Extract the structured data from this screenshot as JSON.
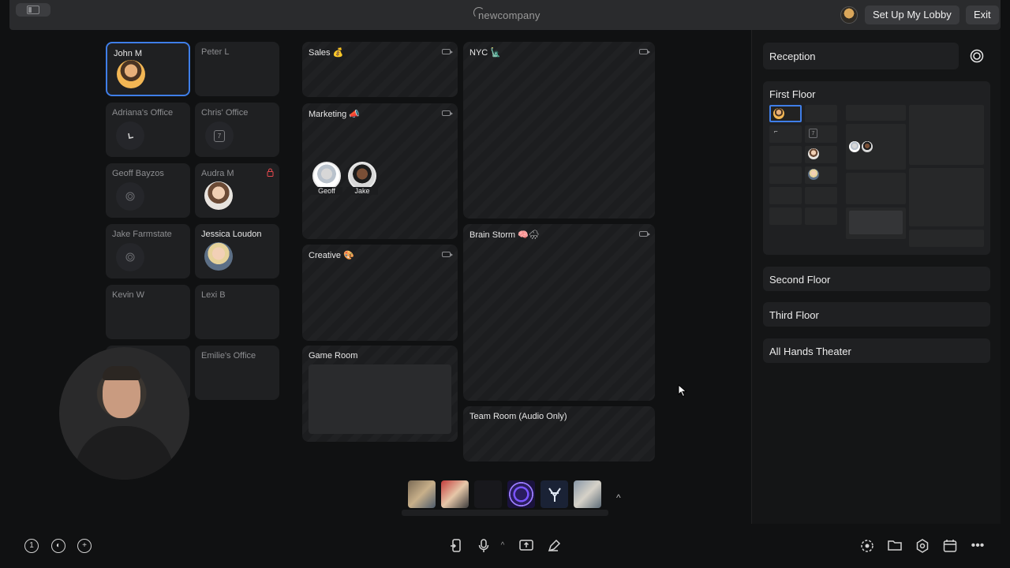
{
  "app": {
    "logo_text": "newcompany",
    "setup_lobby_label": "Set Up My Lobby",
    "exit_label": "Exit"
  },
  "offices": [
    {
      "name": "John M"
    },
    {
      "name": "Peter L"
    },
    {
      "name": "Adriana's Office"
    },
    {
      "name": "Chris' Office"
    },
    {
      "name": "Geoff Bayzos"
    },
    {
      "name": "Audra M"
    },
    {
      "name": "Jake Farmstate"
    },
    {
      "name": "Jessica Loudon"
    },
    {
      "name": "Kevin W"
    },
    {
      "name": "Lexi B"
    },
    {
      "name": "Emilie's Office"
    }
  ],
  "chris_office_day": "7",
  "rooms": {
    "sales": "Sales 💰",
    "marketing": "Marketing 📣",
    "creative": "Creative 🎨",
    "game_room": "Game Room",
    "nyc": "NYC 🗽",
    "brain_storm": "Brain Storm 🧠🌧",
    "team_room": "Team Room (Audio Only)"
  },
  "marketing_people": [
    "Geoff",
    "Jake"
  ],
  "floors": {
    "reception": "Reception",
    "first": "First Floor",
    "second": "Second Floor",
    "third": "Third Floor",
    "all_hands": "All Hands Theater"
  },
  "first_floor_map_day": "7",
  "dock": {
    "apps": [
      "photo-app",
      "people-app",
      "dark-app",
      "swirl-app",
      "yankees-app",
      "image-app"
    ],
    "caret": "^"
  },
  "bottom": {
    "left_badge": "1"
  },
  "colors": {
    "accent": "#3f7ee8",
    "lock": "#e5484d"
  }
}
